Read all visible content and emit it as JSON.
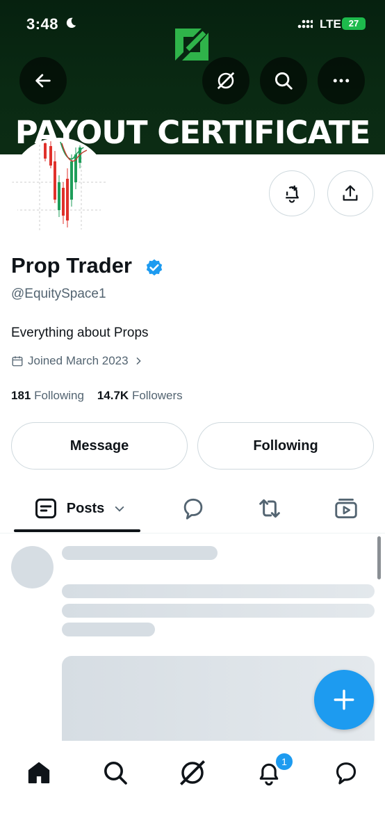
{
  "status_bar": {
    "time": "3:48",
    "network": "LTE",
    "battery": "27"
  },
  "banner": {
    "text": "PAYOUT CERTIFICATE"
  },
  "profile": {
    "name": "Prop Trader",
    "handle": "@EquitySpace1",
    "bio": "Everything about Props",
    "joined": "Joined March 2023",
    "following_count": "181",
    "following_label": "Following",
    "followers_count": "14.7K",
    "followers_label": "Followers"
  },
  "actions": {
    "message": "Message",
    "following": "Following"
  },
  "tabs": {
    "posts": "Posts"
  },
  "notifications": {
    "badge": "1"
  },
  "colors": {
    "accent": "#1d9bf0",
    "banner_green": "#0a2a13",
    "logo_green": "#2fb34a"
  },
  "icons": [
    "back-arrow-icon",
    "grok-icon",
    "search-icon",
    "more-icon",
    "add-notification-icon",
    "share-icon",
    "verified-icon",
    "calendar-icon",
    "chevron-right-icon",
    "posts-icon",
    "chevron-down-icon",
    "reply-icon",
    "repost-icon",
    "media-icon",
    "plus-icon",
    "home-icon"
  ]
}
